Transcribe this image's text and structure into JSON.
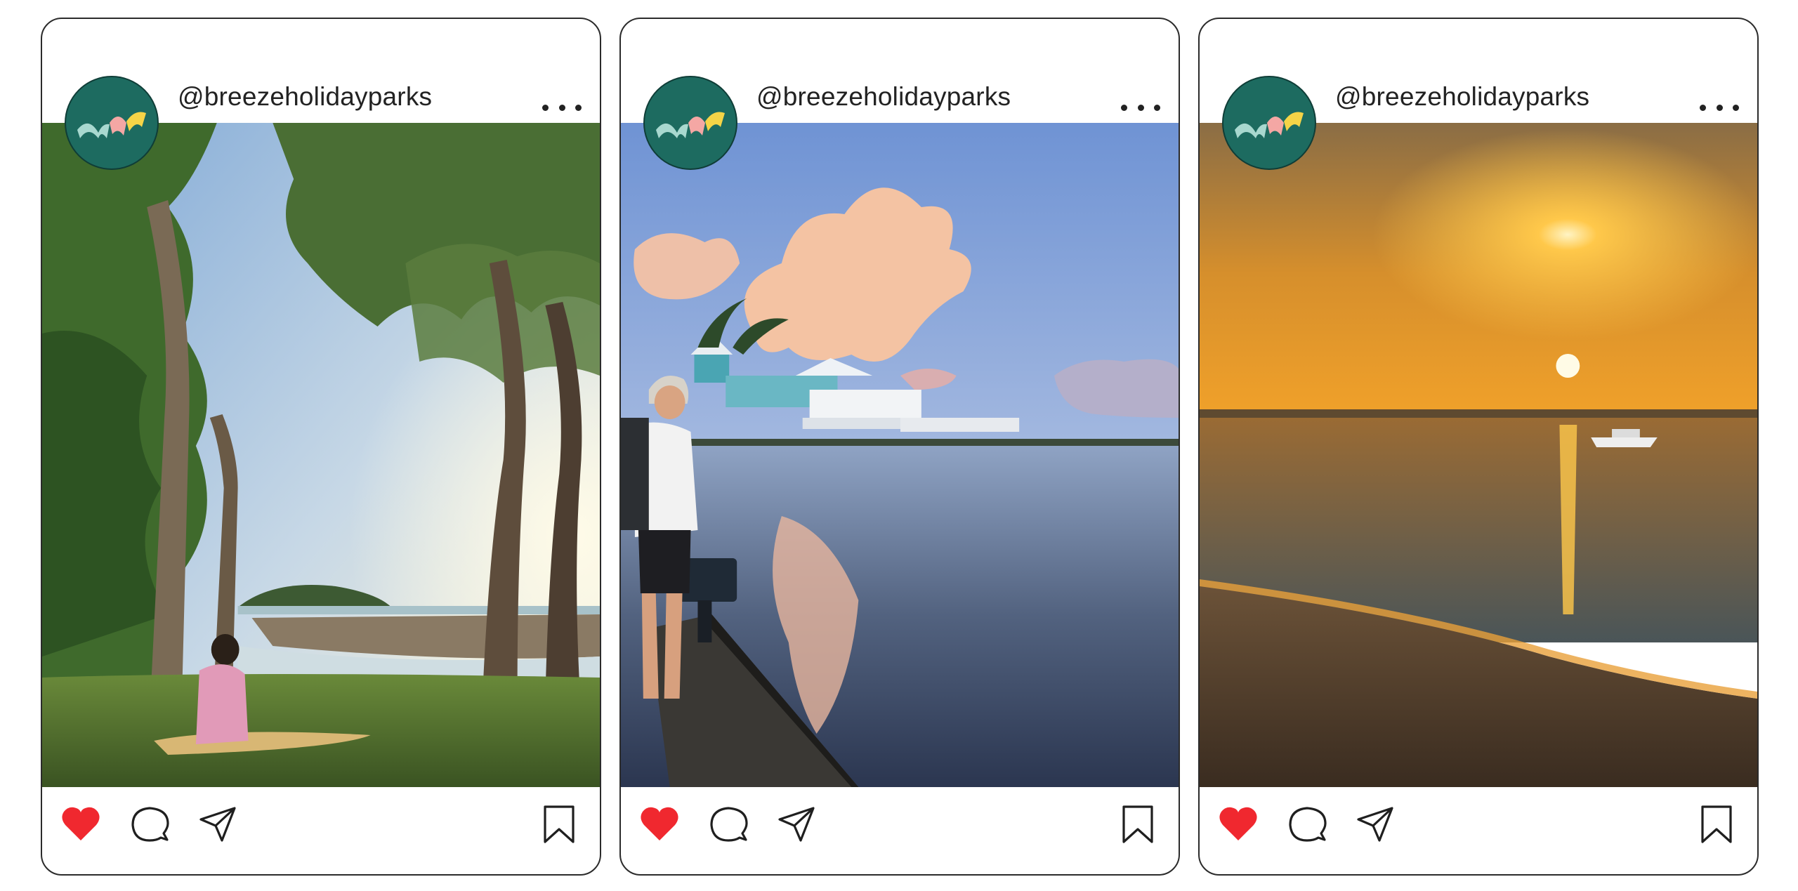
{
  "posts": [
    {
      "username": "@breezeholidayparks",
      "liked": true,
      "colors": {
        "like": "#f0282f"
      }
    },
    {
      "username": "@breezeholidayparks",
      "liked": true,
      "colors": {
        "like": "#f0282f"
      }
    },
    {
      "username": "@breezeholidayparks",
      "liked": true,
      "colors": {
        "like": "#f0282f"
      }
    }
  ],
  "icons": {
    "more": "more-horizontal-icon",
    "like": "heart-icon",
    "comment": "comment-bubble-icon",
    "share": "paper-plane-icon",
    "save": "bookmark-icon"
  },
  "colors": {
    "avatar_bg": "#1d6b60",
    "card_border": "#2b2b2b",
    "text": "#222222"
  }
}
